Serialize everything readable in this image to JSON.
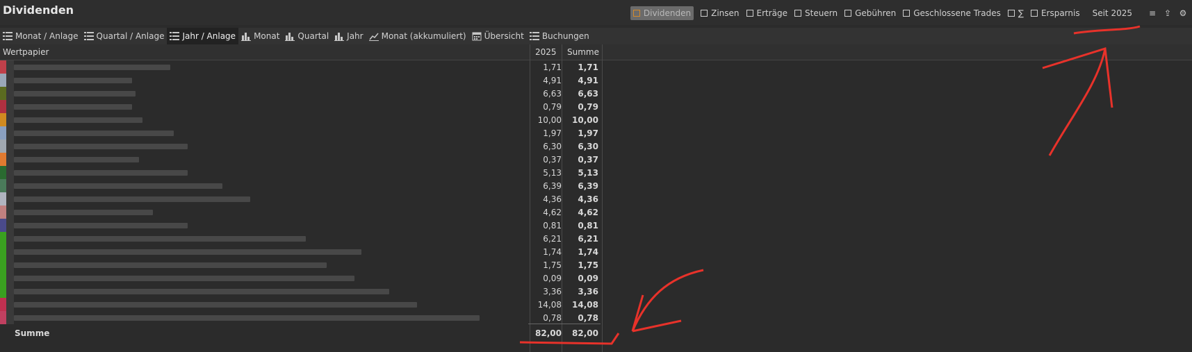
{
  "title": "Dividenden",
  "filters": [
    {
      "label": "Dividenden",
      "active": true
    },
    {
      "label": "Zinsen",
      "active": false
    },
    {
      "label": "Erträge",
      "active": false
    },
    {
      "label": "Steuern",
      "active": false
    },
    {
      "label": "Gebühren",
      "active": false
    },
    {
      "label": "Geschlossene Trades",
      "active": false
    },
    {
      "label": "∑",
      "active": false
    },
    {
      "label": "Ersparnis",
      "active": false
    }
  ],
  "since": "Seit 2025",
  "tabs": [
    {
      "label": "Monat / Anlage",
      "icon": "list-icon"
    },
    {
      "label": "Quartal / Anlage",
      "icon": "list-icon"
    },
    {
      "label": "Jahr / Anlage",
      "icon": "list-icon",
      "active": true
    },
    {
      "label": "Monat",
      "icon": "bar-chart-icon"
    },
    {
      "label": "Quartal",
      "icon": "bar-chart-icon"
    },
    {
      "label": "Jahr",
      "icon": "bar-chart-icon"
    },
    {
      "label": "Monat (akkumuliert)",
      "icon": "line-chart-icon"
    },
    {
      "label": "Übersicht",
      "icon": "calendar-icon"
    },
    {
      "label": "Buchungen",
      "icon": "list-icon"
    }
  ],
  "table": {
    "headers": {
      "security": "Wertpapier",
      "year": "2025",
      "sum": "Summe"
    },
    "rows": [
      {
        "v": "1,71",
        "s": "1,71",
        "c": "#c0404a"
      },
      {
        "v": "4,91",
        "s": "4,91",
        "c": "#9aa7b8"
      },
      {
        "v": "6,63",
        "s": "6,63",
        "c": "#5b6b20"
      },
      {
        "v": "0,79",
        "s": "0,79",
        "c": "#b03040"
      },
      {
        "v": "10,00",
        "s": "10,00",
        "c": "#d08a20"
      },
      {
        "v": "1,97",
        "s": "1,97",
        "c": "#8aa0c0"
      },
      {
        "v": "6,30",
        "s": "6,30",
        "c": "#a0a8b0"
      },
      {
        "v": "0,37",
        "s": "0,37",
        "c": "#e07a30"
      },
      {
        "v": "5,13",
        "s": "5,13",
        "c": "#2a6a30"
      },
      {
        "v": "6,39",
        "s": "6,39",
        "c": "#4a7a5a"
      },
      {
        "v": "4,36",
        "s": "4,36",
        "c": "#b0b4c0"
      },
      {
        "v": "4,62",
        "s": "4,62",
        "c": "#c08080"
      },
      {
        "v": "0,81",
        "s": "0,81",
        "c": "#4a4a8a"
      },
      {
        "v": "6,21",
        "s": "6,21",
        "c": "#3aa020"
      },
      {
        "v": "1,74",
        "s": "1,74",
        "c": "#3aa020"
      },
      {
        "v": "1,75",
        "s": "1,75",
        "c": "#3aa020"
      },
      {
        "v": "0,09",
        "s": "0,09",
        "c": "#3aa020"
      },
      {
        "v": "3,36",
        "s": "3,36",
        "c": "#3aa020"
      },
      {
        "v": "14,08",
        "s": "14,08",
        "c": "#c03050"
      },
      {
        "v": "0,78",
        "s": "0,78",
        "c": "#c04060"
      }
    ],
    "sum": {
      "label": "Summe",
      "v": "82,00",
      "s": "82,00"
    }
  }
}
